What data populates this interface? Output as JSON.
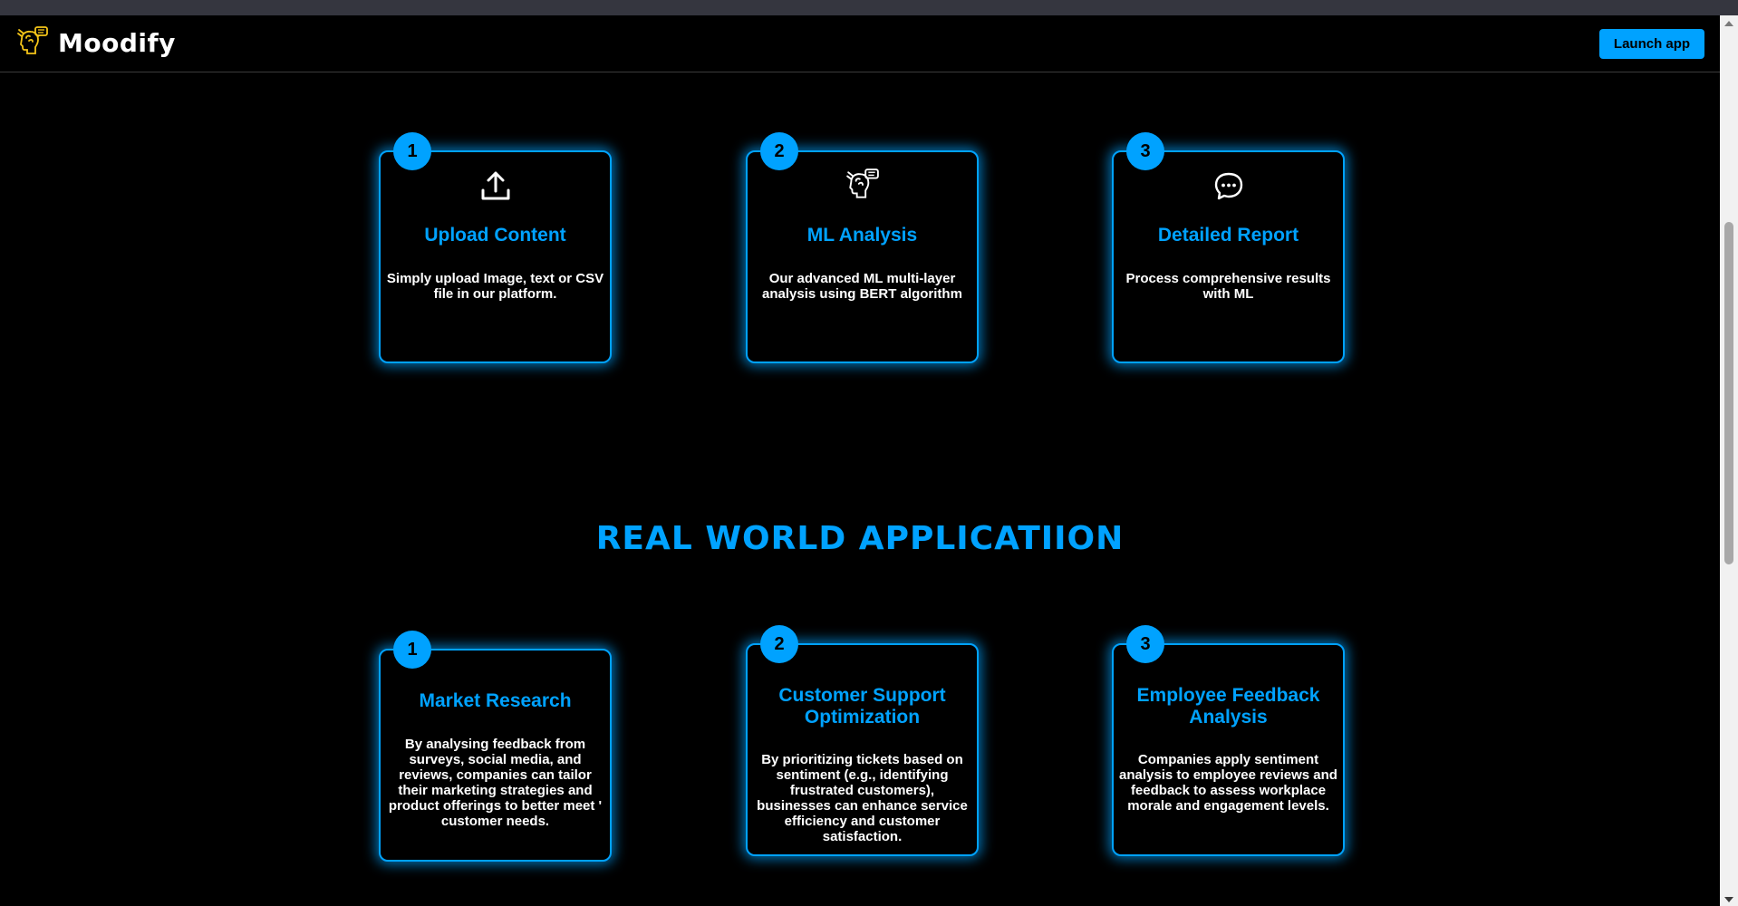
{
  "app": {
    "name": "Moodify"
  },
  "navbar": {
    "launch_label": "Launch app"
  },
  "how_it_works": [
    {
      "number": "1",
      "icon": "upload-icon",
      "title": "Upload Content",
      "text": "Simply upload Image, text or CSV file in our platform."
    },
    {
      "number": "2",
      "icon": "brain-chat-icon",
      "title": "ML Analysis",
      "text": "Our advanced ML multi-layer analysis using BERT algorithm"
    },
    {
      "number": "3",
      "icon": "chat-bubble-icon",
      "title": "Detailed Report",
      "text": "Process comprehensive results with ML"
    }
  ],
  "applications_heading": "REAL WORLD APPLICATIION",
  "applications": [
    {
      "number": "1",
      "title": "Market Research",
      "text": "By analysing feedback from surveys, social media, and reviews, companies can tailor their marketing strategies and product offerings to better meet ' customer needs."
    },
    {
      "number": "2",
      "title": "Customer Support Optimization",
      "text": "By prioritizing tickets based on sentiment (e.g., identifying frustrated customers), businesses can enhance service efficiency and customer satisfaction."
    },
    {
      "number": "3",
      "title": "Employee Feedback Analysis",
      "text": "Companies apply sentiment analysis to employee reviews and feedback to assess workplace morale and engagement levels."
    }
  ],
  "colors": {
    "accent": "#00a2ff",
    "background": "#000000",
    "logo": "#f5c518"
  }
}
